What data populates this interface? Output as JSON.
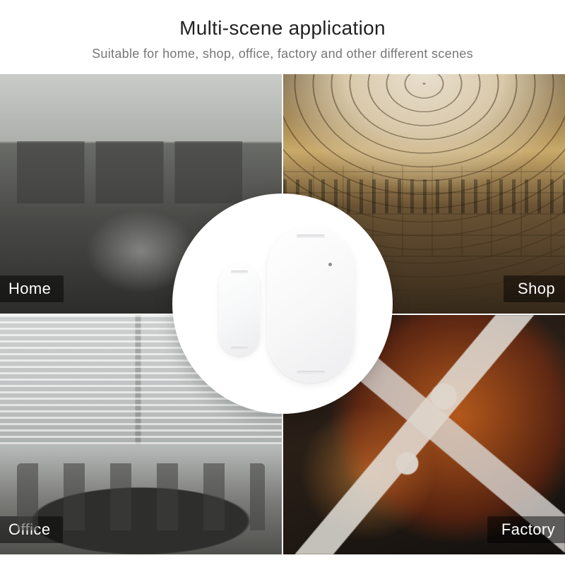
{
  "header": {
    "title": "Multi-scene application",
    "subtitle": "Suitable for home, shop, office, factory and other different scenes"
  },
  "scenes": {
    "top_left": "Home",
    "top_right": "Shop",
    "bottom_left": "Office",
    "bottom_right": "Factory"
  }
}
